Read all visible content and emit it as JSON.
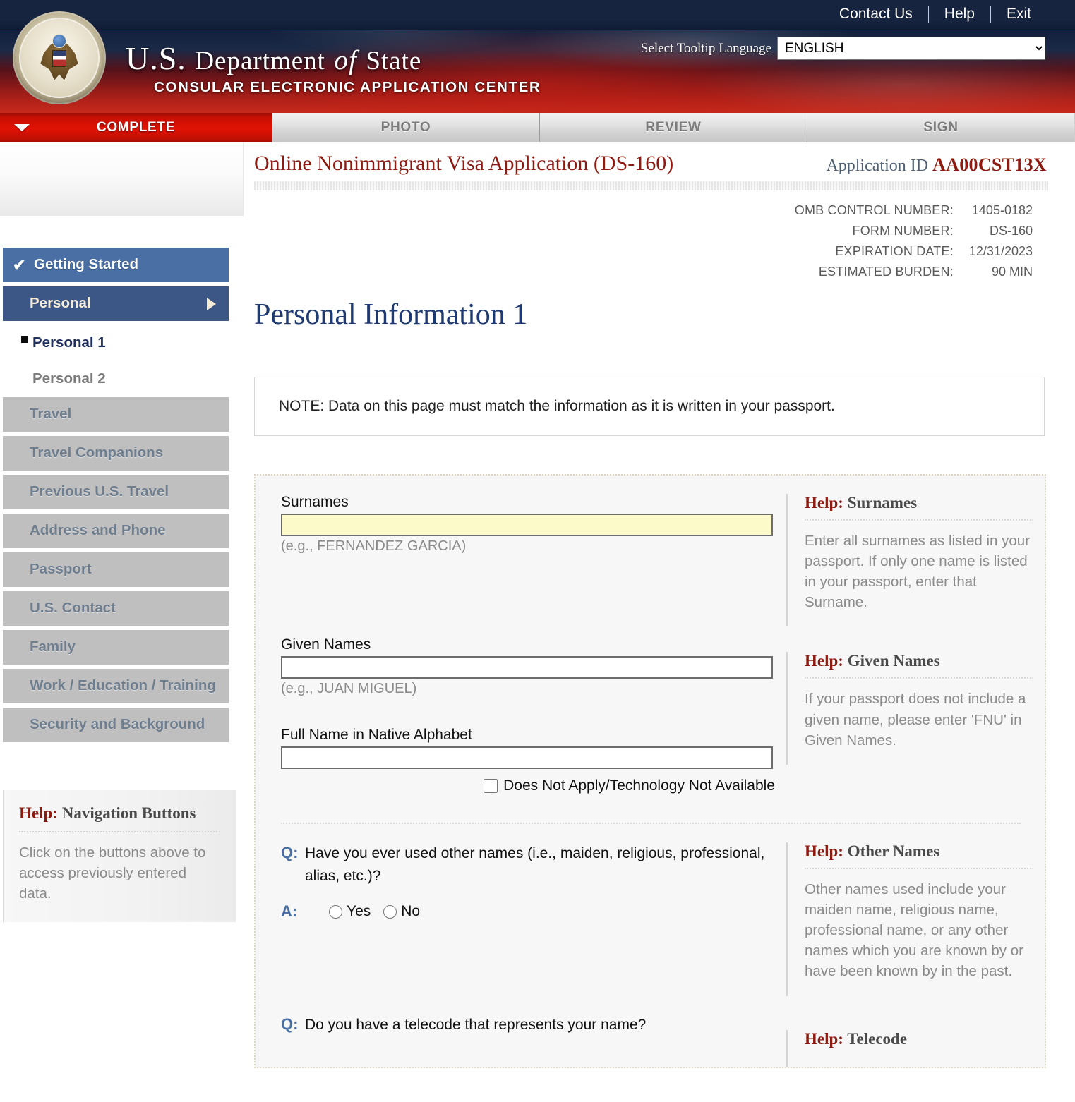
{
  "header": {
    "top_links": [
      "Contact Us",
      "Help",
      "Exit"
    ],
    "language_label": "Select Tooltip Language",
    "language_value": "ENGLISH",
    "language_options": [
      "ENGLISH"
    ],
    "agency_title_us": "U.S.",
    "agency_title_department": "Department",
    "agency_title_of": "of",
    "agency_title_state": "State",
    "agency_subtitle": "CONSULAR ELECTRONIC APPLICATION CENTER",
    "seal_name": "department-of-state-seal"
  },
  "tabs": [
    {
      "label": "COMPLETE",
      "state": "active"
    },
    {
      "label": "PHOTO",
      "state": "inactive"
    },
    {
      "label": "REVIEW",
      "state": "inactive"
    },
    {
      "label": "SIGN",
      "state": "inactive"
    }
  ],
  "sidebar": {
    "items": [
      {
        "label": "Getting Started",
        "type": "done"
      },
      {
        "label": "Personal",
        "type": "current-group"
      },
      {
        "label": "Personal 1",
        "type": "sub-active"
      },
      {
        "label": "Personal 2",
        "type": "sub-inactive"
      },
      {
        "label": "Travel",
        "type": "locked"
      },
      {
        "label": "Travel Companions",
        "type": "locked"
      },
      {
        "label": "Previous U.S. Travel",
        "type": "locked"
      },
      {
        "label": "Address and Phone",
        "type": "locked"
      },
      {
        "label": "Passport",
        "type": "locked"
      },
      {
        "label": "U.S. Contact",
        "type": "locked"
      },
      {
        "label": "Family",
        "type": "locked"
      },
      {
        "label": "Work / Education / Training",
        "type": "locked"
      },
      {
        "label": "Security and Background",
        "type": "locked"
      }
    ],
    "help": {
      "prefix": "Help:",
      "title": "Navigation Buttons",
      "body": "Click on the buttons above to access previously entered data."
    }
  },
  "main": {
    "app_title": "Online Nonimmigrant Visa Application (DS-160)",
    "app_id_label": "Application ID",
    "app_id_value": "AA00CST13X",
    "meta": [
      {
        "key": "OMB CONTROL NUMBER:",
        "value": "1405-0182"
      },
      {
        "key": "FORM NUMBER:",
        "value": "DS-160"
      },
      {
        "key": "EXPIRATION DATE:",
        "value": "12/31/2023"
      },
      {
        "key": "ESTIMATED BURDEN:",
        "value": "90 MIN"
      }
    ],
    "page_heading": "Personal Information 1",
    "note": "NOTE: Data on this page must match the information as it is written in your passport."
  },
  "form": {
    "surnames": {
      "label": "Surnames",
      "value": "",
      "placeholder": "",
      "hint": "(e.g., FERNANDEZ GARCIA)"
    },
    "given_names": {
      "label": "Given Names",
      "value": "",
      "placeholder": "",
      "hint": "(e.g., JUAN MIGUEL)"
    },
    "native_name": {
      "label": "Full Name in Native Alphabet",
      "value": "",
      "placeholder": "",
      "checkbox_label": "Does Not Apply/Technology Not Available",
      "checkbox_checked": false
    },
    "questions": [
      {
        "q_mark": "Q:",
        "a_mark": "A:",
        "text": "Have you ever used other names (i.e., maiden, religious, professional, alias, etc.)?",
        "options": [
          "Yes",
          "No"
        ],
        "selected": ""
      },
      {
        "q_mark": "Q:",
        "text": "Do you have a telecode that represents your name?"
      }
    ]
  },
  "help_panels": [
    {
      "prefix": "Help:",
      "title": "Surnames",
      "body": "Enter all surnames as listed in your passport. If only one name is listed in your passport, enter that Surname."
    },
    {
      "prefix": "Help:",
      "title": "Given Names",
      "body": "If your passport does not include a given name, please enter 'FNU' in Given Names."
    },
    {
      "prefix": "Help:",
      "title": "Other Names",
      "body": "Other names used include your maiden name, religious name, professional name, or any other names which you are known by or have been known by in the past."
    },
    {
      "prefix": "Help:",
      "title": "Telecode",
      "body": ""
    }
  ],
  "colors": {
    "accent_red": "#c90f04",
    "header_navy": "#16243f",
    "title_red": "#8e1b12",
    "heading_blue": "#1f3a70",
    "nav_done": "#4a6fa5",
    "nav_current": "#3c5685",
    "nav_locked": "#bfbfbf",
    "required_field": "#fbfac8"
  }
}
